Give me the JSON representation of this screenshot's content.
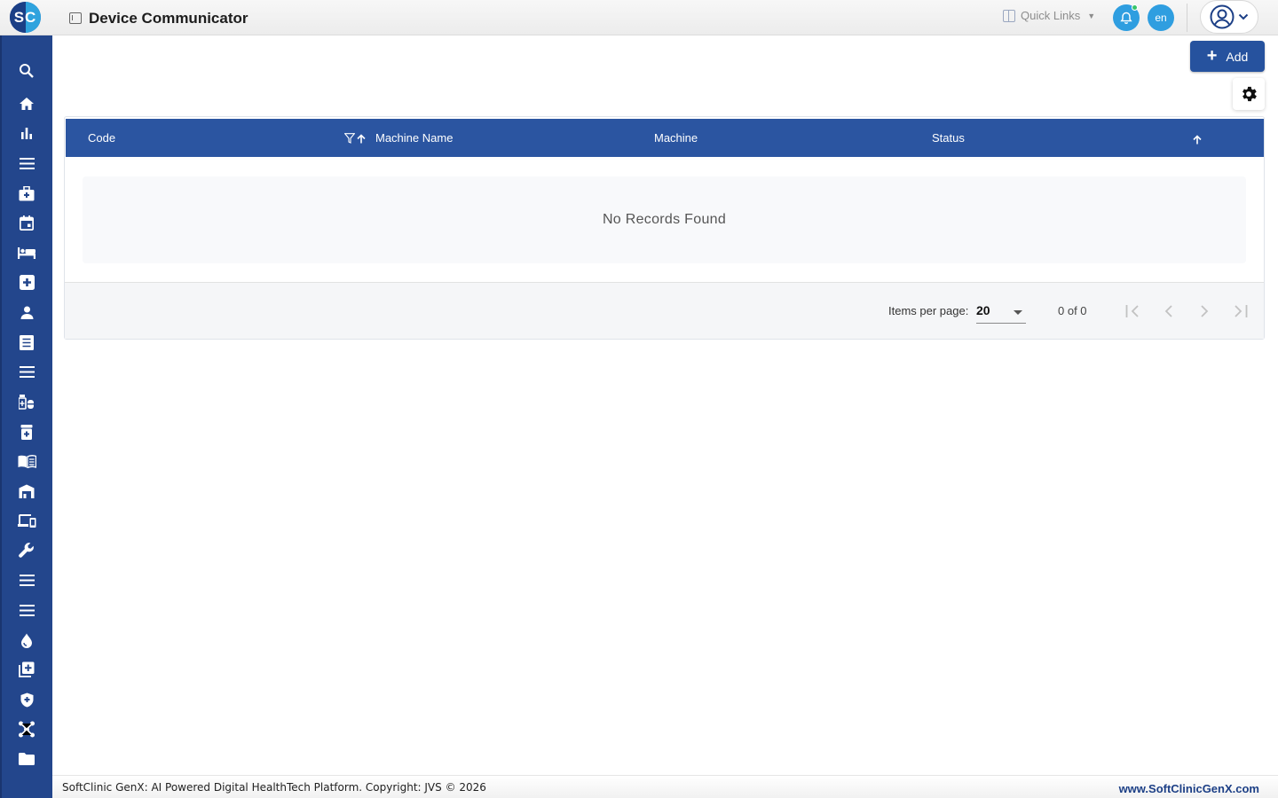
{
  "header": {
    "logo_text": "SC",
    "title": "Device Communicator",
    "quick_links": "Quick Links",
    "lang": "en"
  },
  "sidebar": {
    "items": [
      {
        "name": "search-icon"
      },
      {
        "name": "home-icon"
      },
      {
        "name": "bar-chart-icon"
      },
      {
        "name": "menu-icon"
      },
      {
        "name": "medical-bag-icon"
      },
      {
        "name": "calendar-icon"
      },
      {
        "name": "bed-icon"
      },
      {
        "name": "medical-plus-icon"
      },
      {
        "name": "person-icon"
      },
      {
        "name": "document-icon"
      },
      {
        "name": "menu-icon"
      },
      {
        "name": "pharmacy-icon"
      },
      {
        "name": "medicine-bottle-icon"
      },
      {
        "name": "book-icon"
      },
      {
        "name": "warehouse-icon"
      },
      {
        "name": "devices-icon"
      },
      {
        "name": "wrench-icon"
      },
      {
        "name": "menu-icon"
      },
      {
        "name": "menu-icon"
      },
      {
        "name": "blood-drop-icon"
      },
      {
        "name": "add-library-icon"
      },
      {
        "name": "shield-icon"
      },
      {
        "name": "network-icon"
      },
      {
        "name": "folder-icon"
      }
    ]
  },
  "toolbar": {
    "add_label": "Add"
  },
  "table": {
    "columns": [
      "Code",
      "Machine Name",
      "Machine",
      "Status"
    ],
    "empty_text": "No Records Found"
  },
  "pager": {
    "items_per_page_label": "Items per page:",
    "items_per_page": "20",
    "range": "0 of 0"
  },
  "footer": {
    "left": "SoftClinic GenX: AI Powered Digital HealthTech Platform. Copyright: JVS © 2026",
    "right": "www.SoftClinicGenX.com"
  },
  "colors": {
    "primary": "#26529e",
    "sidebar": "#23468c",
    "accent": "#2f9ee0"
  }
}
